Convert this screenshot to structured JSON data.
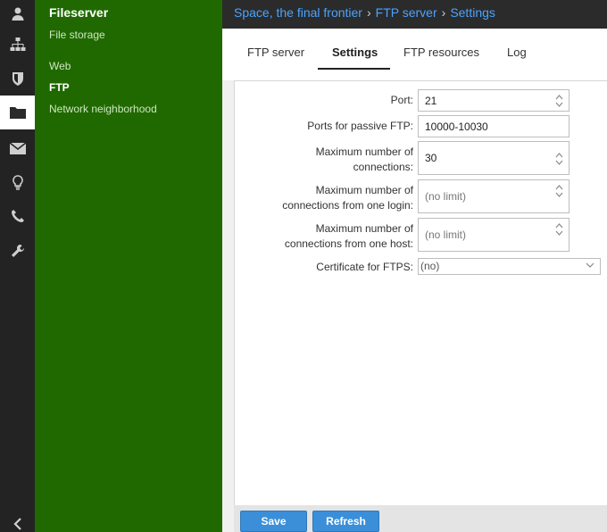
{
  "nav": {
    "title": "Fileserver",
    "subtitle": "File storage",
    "items": [
      {
        "label": "Web",
        "active": false
      },
      {
        "label": "FTP",
        "active": true
      },
      {
        "label": "Network neighborhood",
        "active": false
      }
    ]
  },
  "breadcrumb": [
    "Space, the final frontier",
    "FTP server",
    "Settings"
  ],
  "tabs": [
    {
      "label": "FTP server",
      "active": false
    },
    {
      "label": "Settings",
      "active": true
    },
    {
      "label": "FTP resources",
      "active": false
    },
    {
      "label": "Log",
      "active": false
    }
  ],
  "form": {
    "port": {
      "label": "Port:",
      "value": "21"
    },
    "passive_ports": {
      "label": "Ports for passive FTP:",
      "value": "10000-10030"
    },
    "max_connections": {
      "label_1": "Maximum number of",
      "label_2": "connections:",
      "value": "30"
    },
    "max_login": {
      "label_1": "Maximum number of",
      "label_2": "connections from one login:",
      "placeholder": "(no limit)"
    },
    "max_host": {
      "label_1": "Maximum number of",
      "label_2": "connections from one host:",
      "placeholder": "(no limit)"
    },
    "certificate": {
      "label": "Certificate for FTPS:",
      "value": "(no)"
    }
  },
  "buttons": {
    "save": "Save",
    "refresh": "Refresh"
  },
  "colors": {
    "rail": "#232323",
    "nav": "#1f6900",
    "topbar": "#2b2b2b",
    "link": "#4aa3ff",
    "button": "#3b8fd9"
  }
}
